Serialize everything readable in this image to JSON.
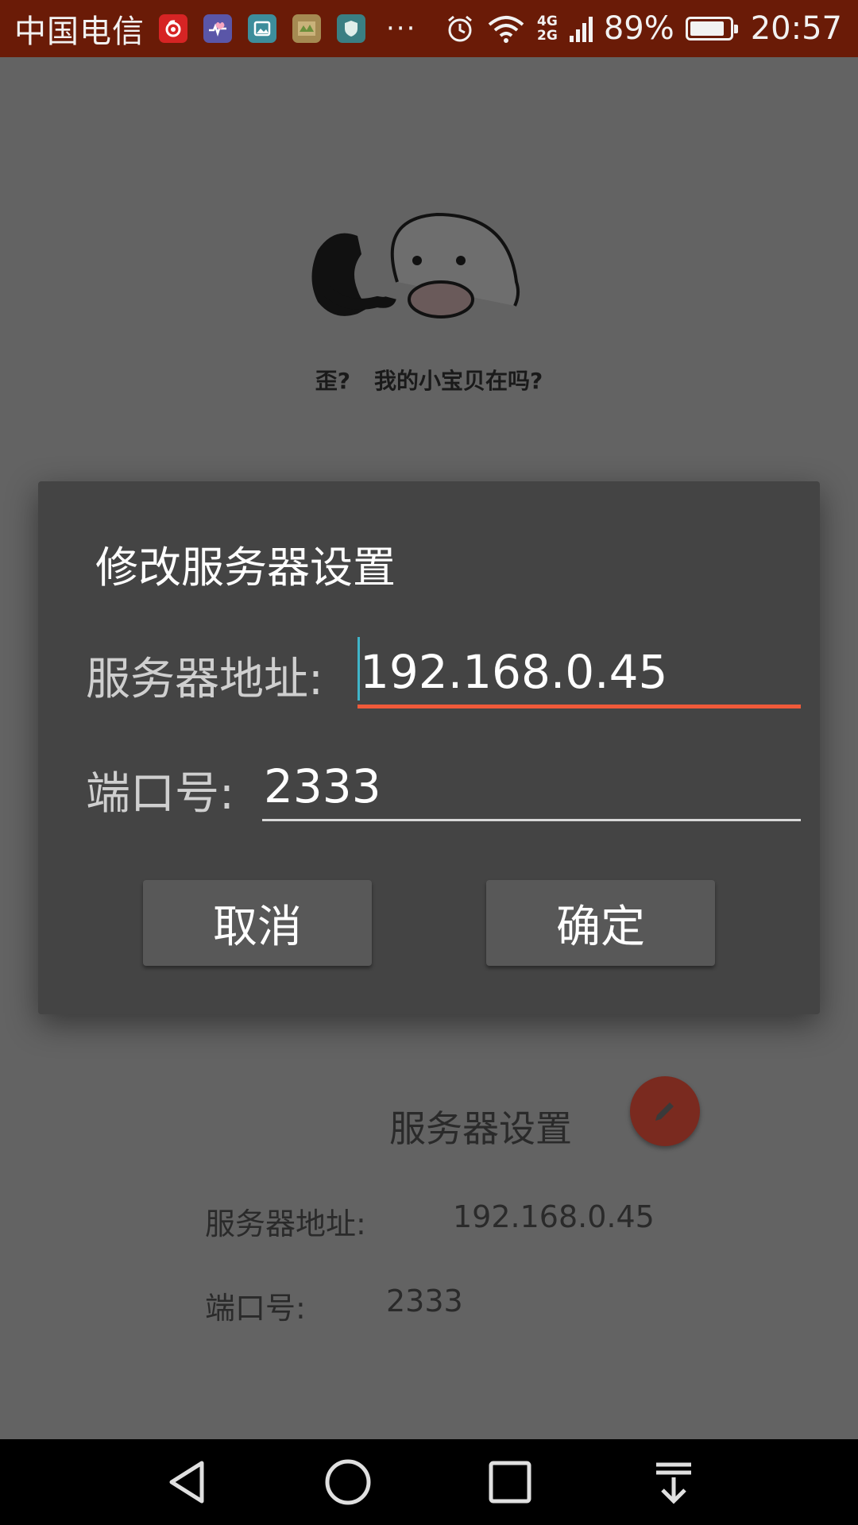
{
  "status_bar": {
    "carrier": "中国电信",
    "more": "···",
    "network_top": "4G",
    "network_bottom": "2G",
    "battery_percent": "89%",
    "battery_level": 0.89,
    "time": "20:57",
    "notification_icons": [
      "netease-music-icon",
      "health-icon",
      "gallery-icon",
      "game-icon",
      "security-shield-icon"
    ]
  },
  "background": {
    "mascot_caption_1": "歪?",
    "mascot_caption_2": "我的小宝贝在吗?",
    "settings_title": "服务器设置",
    "server_address_label": "服务器地址:",
    "server_address_value": "192.168.0.45",
    "port_label": "端口号:",
    "port_value": "2333"
  },
  "dialog": {
    "title": "修改服务器设置",
    "server_label": "服务器地址:",
    "server_value": "192.168.0.45",
    "port_label": "端口号:",
    "port_value": "2333",
    "cancel_label": "取消",
    "confirm_label": "确定"
  },
  "colors": {
    "status_bar": "#6a1b07",
    "overlay_bg": "#636363",
    "dialog_bg": "#444444",
    "active_underline": "#f05a3a",
    "caret": "#3fb5c9",
    "fab": "#7a2a1f"
  }
}
